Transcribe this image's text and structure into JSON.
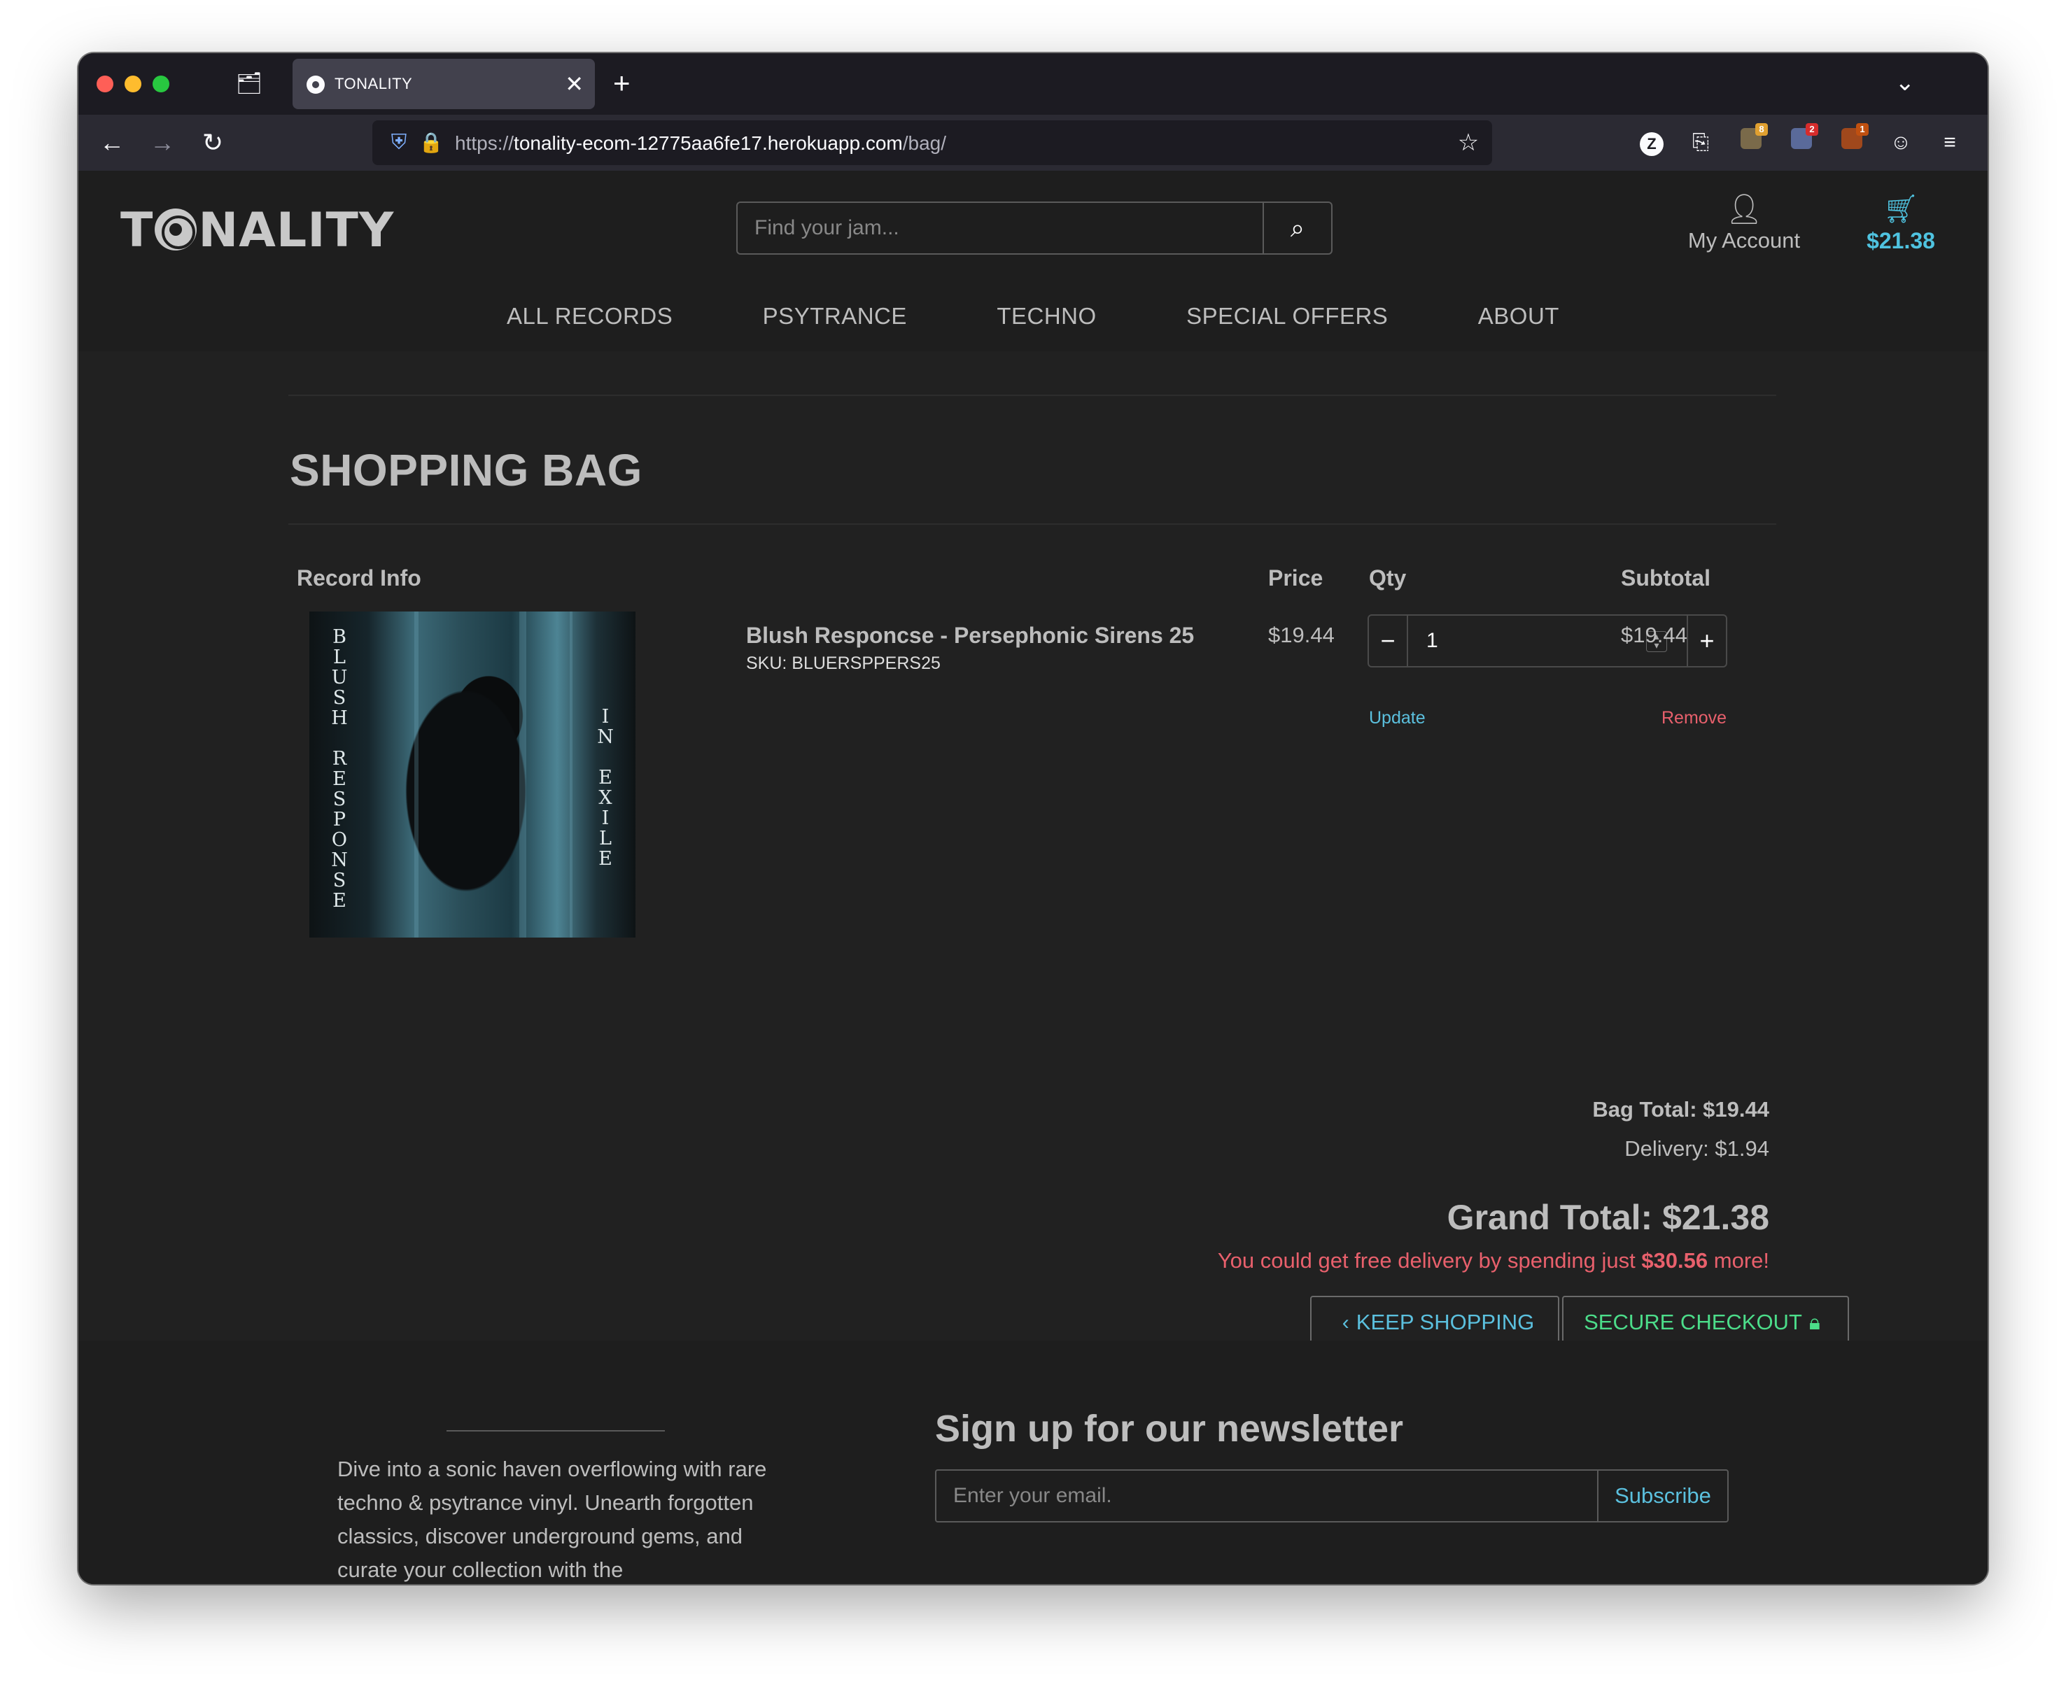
{
  "browser": {
    "tab_title": "TONALITY",
    "url_prefix": "https://",
    "url_host": "tonality-ecom-12775aa6fe17.herokuapp.com",
    "url_path": "/bag/",
    "extension_badges": [
      "8",
      "2",
      "1"
    ]
  },
  "header": {
    "logo_left": "T",
    "logo_right": "NALITY",
    "search_placeholder": "Find your jam...",
    "account_label": "My Account",
    "bag_total": "$21.38"
  },
  "nav": {
    "items": [
      "ALL RECORDS",
      "PSYTRANCE",
      "TECHNO",
      "SPECIAL OFFERS",
      "ABOUT"
    ]
  },
  "bag": {
    "title": "SHOPPING BAG",
    "headers": {
      "info": "Record Info",
      "price": "Price",
      "qty": "Qty",
      "subtotal": "Subtotal"
    },
    "items": [
      {
        "name": "Blush Responcse - Persephonic Sirens 25",
        "sku": "SKU: BLUERSPPERS25",
        "price": "$19.44",
        "qty": "1",
        "subtotal": "$19.44",
        "update_label": "Update",
        "remove_label": "Remove",
        "art_left": [
          "B",
          "L",
          "U",
          "S",
          "H",
          "",
          "R",
          "E",
          "S",
          "P",
          "O",
          "N",
          "S",
          "E"
        ],
        "art_right": [
          "I",
          "N",
          "",
          "E",
          "X",
          "I",
          "L",
          "E"
        ]
      }
    ],
    "bag_total": "Bag Total: $19.44",
    "delivery": "Delivery: $1.94",
    "grand_total": "Grand Total: $21.38",
    "free_delivery_prefix": "You could get free delivery by spending just ",
    "free_delivery_amount": "$30.56",
    "free_delivery_suffix": " more!",
    "keep_shopping": "KEEP SHOPPING",
    "secure_checkout": "SECURE CHECKOUT"
  },
  "footer": {
    "blurb": "Dive into a sonic haven overflowing with rare techno & psytrance vinyl. Unearth forgotten classics, discover underground gems, and curate your collection with the",
    "newsletter_title": "Sign up for our newsletter",
    "email_placeholder": "Enter your email.",
    "subscribe_label": "Subscribe"
  },
  "colors": {
    "accent_blue": "#5bc0de",
    "bag_blue": "#4fc3e0",
    "remove_red": "#e8606c",
    "checkout_green": "#4cdd8a",
    "page_bg": "#212121"
  }
}
